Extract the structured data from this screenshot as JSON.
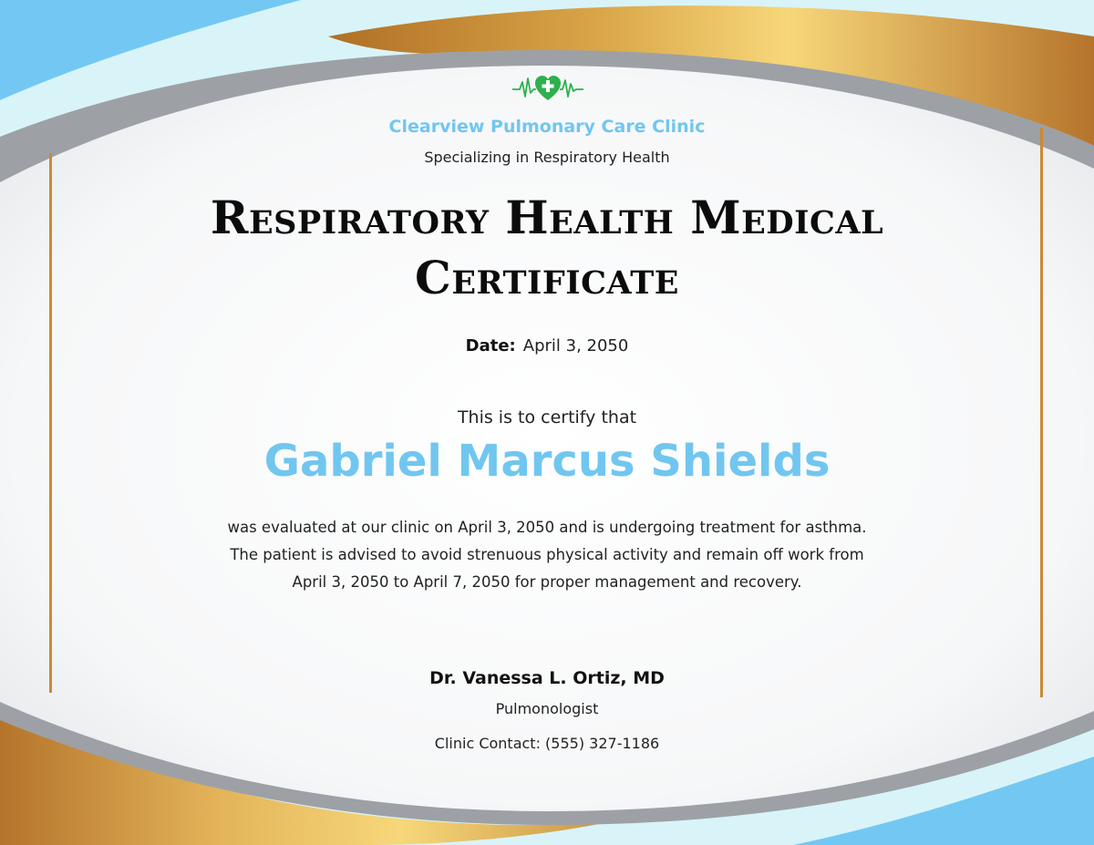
{
  "clinic": {
    "name": "Clearview Pulmonary Care Clinic",
    "tagline": "Specializing in Respiratory Health"
  },
  "certificate": {
    "title": "Respiratory Health Medical Certificate",
    "date_label": "Date:",
    "date_value": "April 3, 2050",
    "certify_intro": "This is to certify that",
    "patient_name": "Gabriel Marcus Shields",
    "body_lines": [
      "was evaluated at our clinic on April 3, 2050 and is undergoing treatment for asthma.",
      "The patient is advised to avoid strenuous physical activity and remain off work from",
      "April 3, 2050 to April 7, 2050 for proper management and recovery."
    ]
  },
  "signature": {
    "doctor": "Dr. Vanessa L. Ortiz, MD",
    "role": "Pulmonologist",
    "contact": "Clinic Contact: (555) 327-1186"
  },
  "colors": {
    "accent_blue": "#71c6f0",
    "gold": "#c98a35",
    "logo_green": "#2eb04f"
  },
  "icons": {
    "logo": "heart-cross-heartbeat-icon"
  }
}
